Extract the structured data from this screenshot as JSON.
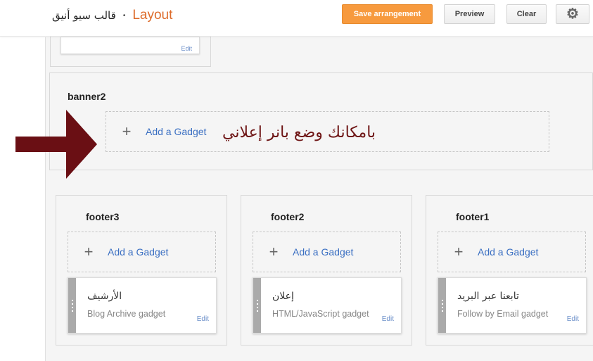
{
  "header": {
    "site_name": "قالب سيو أنيق",
    "separator": "•",
    "page_title": "Layout",
    "save_label": "Save arrangement",
    "preview_label": "Preview",
    "clear_label": "Clear",
    "gear_icon": "gear-icon"
  },
  "top_partial": {
    "edit_label": "Edit"
  },
  "banner": {
    "title": "banner2",
    "add_gadget": "Add a Gadget",
    "annotation": "بامكانك وضع بانر إعلاني"
  },
  "footers": [
    {
      "title": "footer3",
      "add_gadget": "Add a Gadget",
      "gadget_title": "الأرشيف",
      "gadget_type": "Blog Archive gadget",
      "edit": "Edit"
    },
    {
      "title": "footer2",
      "add_gadget": "Add a Gadget",
      "gadget_title": "إعلان",
      "gadget_type": "HTML/JavaScript gadget",
      "edit": "Edit"
    },
    {
      "title": "footer1",
      "add_gadget": "Add a Gadget",
      "gadget_title": "تابعنا عبر البريد",
      "gadget_type": "Follow by Email gadget",
      "edit": "Edit"
    }
  ],
  "colors": {
    "accent_orange": "#f79a3e",
    "link_blue": "#3a6fc2",
    "annotation_red": "#6e1515"
  }
}
